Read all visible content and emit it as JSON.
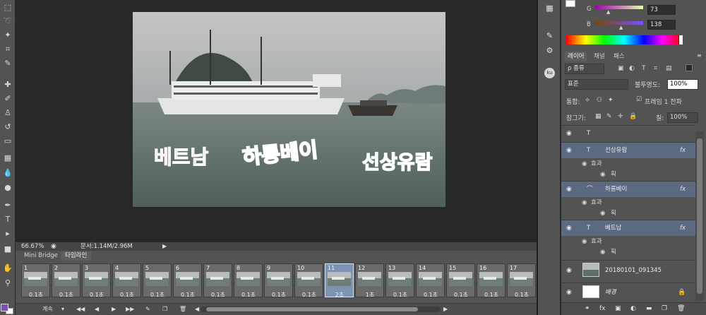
{
  "toolbar": {
    "icons": [
      "marquee-icon",
      "lasso-icon",
      "quick-select-icon",
      "crop-icon",
      "eyedropper-icon",
      "healing-icon",
      "brush-icon",
      "stamp-icon",
      "history-brush-icon",
      "eraser-icon",
      "gradient-icon",
      "blur-icon",
      "dodge-icon",
      "pen-icon",
      "type-icon",
      "path-select-icon",
      "rectangle-icon",
      "hand-icon",
      "zoom-icon"
    ],
    "glyphs": [
      "⬚",
      "➰",
      "✦",
      "⌗",
      "✎",
      "✚",
      "✐",
      "♙",
      "↺",
      "▭",
      "▦",
      "💧",
      "●",
      "✒",
      "T",
      "▸",
      "■",
      "✋",
      "⚲"
    ],
    "fg_color": "#7a52b0",
    "bg_color": "#ffffff"
  },
  "canvas": {
    "text1": "베트남",
    "text2": "하롱베이",
    "text3": "선상유람"
  },
  "status": {
    "zoom": "66.67%",
    "doc": "문서:1.14M/2.96M"
  },
  "timeline": {
    "tabs": [
      "Mini Bridge",
      "타임라인"
    ],
    "frames": [
      {
        "num": "1",
        "delay": "0.1초"
      },
      {
        "num": "2",
        "delay": "0.1초"
      },
      {
        "num": "3",
        "delay": "0.1초"
      },
      {
        "num": "4",
        "delay": "0.1초"
      },
      {
        "num": "5",
        "delay": "0.1초"
      },
      {
        "num": "6",
        "delay": "0.1초"
      },
      {
        "num": "7",
        "delay": "0.1초"
      },
      {
        "num": "8",
        "delay": "0.1초"
      },
      {
        "num": "9",
        "delay": "0.1초"
      },
      {
        "num": "10",
        "delay": "0.1초"
      },
      {
        "num": "11",
        "delay": "2초"
      },
      {
        "num": "12",
        "delay": "1초"
      },
      {
        "num": "13",
        "delay": "0.1초"
      },
      {
        "num": "14",
        "delay": "0.1초"
      },
      {
        "num": "15",
        "delay": "0.1초"
      },
      {
        "num": "16",
        "delay": "0.1초"
      },
      {
        "num": "17",
        "delay": "0.1초"
      }
    ],
    "loop": "계속",
    "buttons": [
      "◀◀",
      "◀",
      "▶",
      "▶▶"
    ]
  },
  "color_panel": {
    "g_label": "G",
    "g_value": "73",
    "b_label": "B",
    "b_value": "138"
  },
  "layers_panel": {
    "tabs": [
      "레이어",
      "채널",
      "패스"
    ],
    "filter": "ρ 종류",
    "blend": "표준",
    "opacity_label": "불투명도:",
    "opacity": "100%",
    "unify_label": "통합:",
    "propagate": "프레임 1 전파",
    "lock_label": "잠그기:",
    "fill_label": "칠:",
    "fill": "100%",
    "layers": [
      {
        "name": "",
        "type": "T"
      },
      {
        "name": "선상유람",
        "type": "T"
      },
      {
        "name": "하롱베이",
        "type": "warp-T"
      },
      {
        "name": "베트남",
        "type": "T"
      },
      {
        "name": "20180101_091345",
        "type": "image"
      },
      {
        "name": "배경",
        "type": "background"
      }
    ],
    "effects_label": "효과",
    "stroke_label": "획",
    "fx": "fx"
  }
}
